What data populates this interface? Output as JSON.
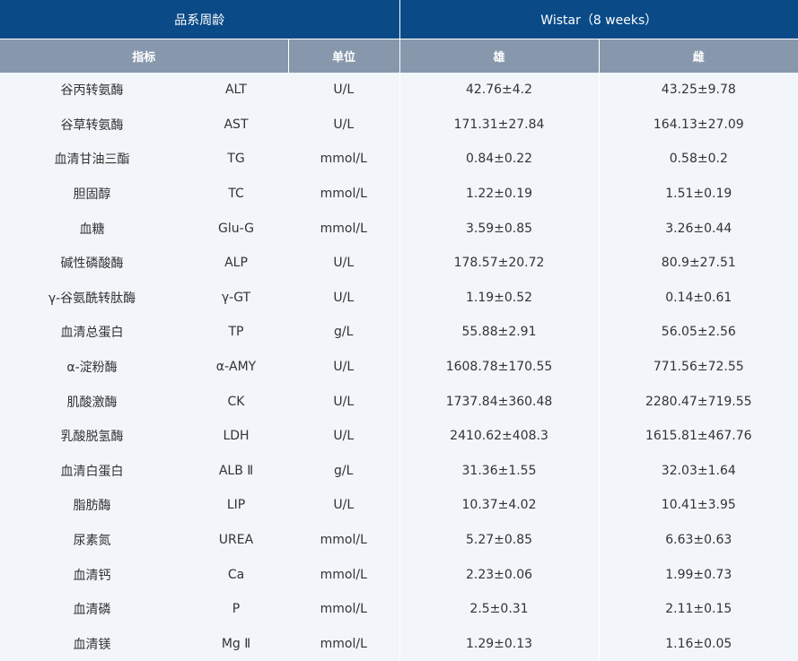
{
  "header": {
    "strain_label": "品系周龄",
    "strain_value": "Wistar（8 weeks）"
  },
  "columns": {
    "indicator": "指标",
    "unit": "单位",
    "male": "雄",
    "female": "雌"
  },
  "rows": [
    {
      "name": "谷丙转氨酶",
      "abbr": "ALT",
      "unit": "U/L",
      "male": "42.76±4.2",
      "female": "43.25±9.78"
    },
    {
      "name": "谷草转氨酶",
      "abbr": "AST",
      "unit": "U/L",
      "male": "171.31±27.84",
      "female": "164.13±27.09"
    },
    {
      "name": "血清甘油三酯",
      "abbr": "TG",
      "unit": "mmol/L",
      "male": "0.84±0.22",
      "female": "0.58±0.2"
    },
    {
      "name": "胆固醇",
      "abbr": "TC",
      "unit": "mmol/L",
      "male": "1.22±0.19",
      "female": "1.51±0.19"
    },
    {
      "name": "血糖",
      "abbr": "Glu-G",
      "unit": "mmol/L",
      "male": "3.59±0.85",
      "female": "3.26±0.44"
    },
    {
      "name": "碱性磷酸酶",
      "abbr": "ALP",
      "unit": "U/L",
      "male": "178.57±20.72",
      "female": "80.9±27.51"
    },
    {
      "name": "γ-谷氨酰转肽酶",
      "abbr": "γ-GT",
      "unit": "U/L",
      "male": "1.19±0.52",
      "female": "0.14±0.61"
    },
    {
      "name": "血清总蛋白",
      "abbr": "TP",
      "unit": "g/L",
      "male": "55.88±2.91",
      "female": "56.05±2.56"
    },
    {
      "name": "α-淀粉酶",
      "abbr": "α-AMY",
      "unit": "U/L",
      "male": "1608.78±170.55",
      "female": "771.56±72.55"
    },
    {
      "name": "肌酸激酶",
      "abbr": "CK",
      "unit": "U/L",
      "male": "1737.84±360.48",
      "female": "2280.47±719.55"
    },
    {
      "name": "乳酸脱氢酶",
      "abbr": "LDH",
      "unit": "U/L",
      "male": "2410.62±408.3",
      "female": "1615.81±467.76"
    },
    {
      "name": "血清白蛋白",
      "abbr": "ALB Ⅱ",
      "unit": "g/L",
      "male": "31.36±1.55",
      "female": "32.03±1.64"
    },
    {
      "name": "脂肪酶",
      "abbr": "LIP",
      "unit": "U/L",
      "male": "10.37±4.02",
      "female": "10.41±3.95"
    },
    {
      "name": "尿素氮",
      "abbr": "UREA",
      "unit": "mmol/L",
      "male": "5.27±0.85",
      "female": "6.63±0.63"
    },
    {
      "name": "血清钙",
      "abbr": "Ca",
      "unit": "mmol/L",
      "male": "2.23±0.06",
      "female": "1.99±0.73"
    },
    {
      "name": "血清磷",
      "abbr": "P",
      "unit": "mmol/L",
      "male": "2.5±0.31",
      "female": "2.11±0.15"
    },
    {
      "name": "血清镁",
      "abbr": "Mg Ⅱ",
      "unit": "mmol/L",
      "male": "1.29±0.13",
      "female": "1.16±0.05"
    }
  ],
  "colors": {
    "header_primary": "#094a87",
    "header_secondary": "#8798ac",
    "row_background": "#f2f5fa",
    "text": "#333333"
  }
}
